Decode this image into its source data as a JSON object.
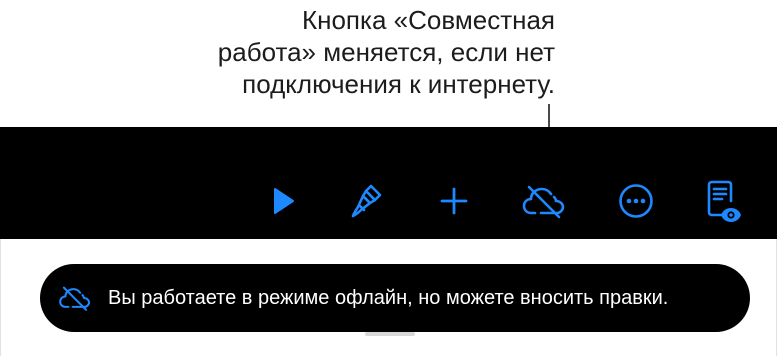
{
  "callout": {
    "lines": [
      "Кнопка «Совместная",
      "работа» меняется, если нет",
      "подключения к интернету."
    ]
  },
  "toolbar": {
    "buttons": [
      {
        "name": "play-button",
        "icon": "play-icon"
      },
      {
        "name": "format-button",
        "icon": "paintbrush-icon"
      },
      {
        "name": "insert-button",
        "icon": "plus-icon"
      },
      {
        "name": "collaboration-button",
        "icon": "cloud-slash-icon"
      },
      {
        "name": "more-button",
        "icon": "ellipsis-circle-icon"
      },
      {
        "name": "presenter-notes-button",
        "icon": "document-eye-icon"
      }
    ],
    "accent_color": "#1e88ff",
    "background_color": "#000000"
  },
  "toast": {
    "icon": "cloud-slash-icon",
    "message": "Вы работаете в режиме офлайн, но можете вносить правки."
  }
}
